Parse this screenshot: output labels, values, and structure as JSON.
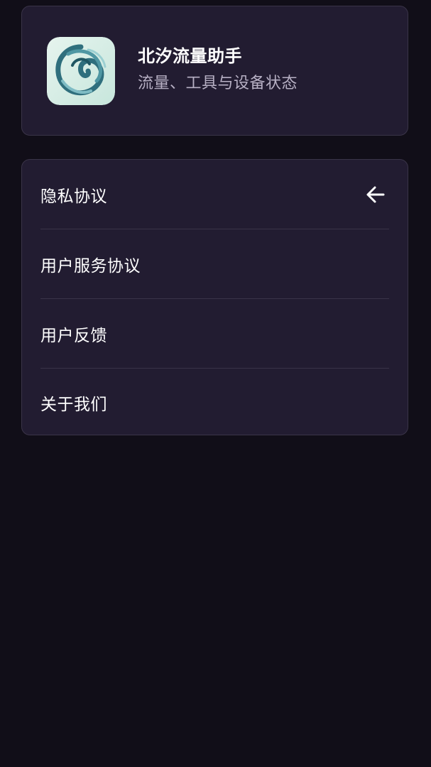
{
  "app": {
    "title": "北汐流量助手",
    "subtitle": "流量、工具与设备状态",
    "icon": "wave-logo-icon"
  },
  "menu": {
    "items": [
      {
        "label": "隐私协议",
        "icon": "arrow-left-icon"
      },
      {
        "label": "用户服务协议"
      },
      {
        "label": "用户反馈"
      },
      {
        "label": "关于我们"
      }
    ]
  },
  "colors": {
    "background": "#110e18",
    "card": "#221c31",
    "border": "#3a3448",
    "subtitle": "#b7b0c4"
  }
}
